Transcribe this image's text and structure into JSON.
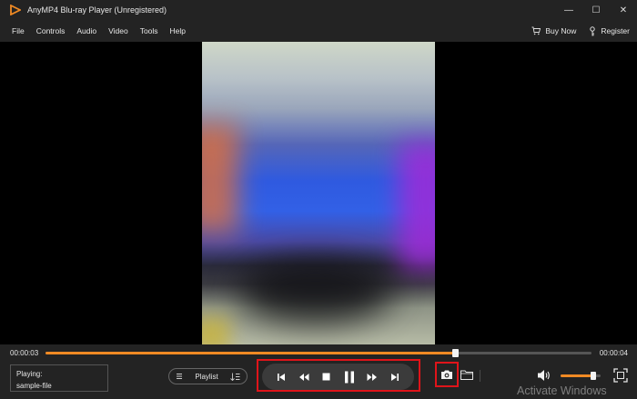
{
  "window": {
    "title": "AnyMP4 Blu-ray Player (Unregistered)",
    "minimize_glyph": "—",
    "maximize_glyph": "☐",
    "close_glyph": "✕"
  },
  "menu": {
    "items": [
      "File",
      "Controls",
      "Audio",
      "Video",
      "Tools",
      "Help"
    ],
    "buy_now": "Buy Now",
    "register": "Register"
  },
  "playback": {
    "current_time": "00:00:03",
    "duration": "00:00:04",
    "progress_fraction": 0.75
  },
  "status": {
    "playing_label": "Playing:",
    "file_name": "sample-file"
  },
  "playlist": {
    "label": "Playlist"
  },
  "volume": {
    "level_fraction": 0.82
  },
  "watermark": {
    "text": "Activate Windows"
  },
  "colors": {
    "accent": "#f08a24",
    "highlight": "#e0141a",
    "chrome": "#232323"
  },
  "icons": {
    "app": "anymp4-logo-icon",
    "buy": "cart-icon",
    "register": "key-icon",
    "previous": "skip-previous-icon",
    "rewind": "rewind-icon",
    "stop": "stop-icon",
    "pause": "pause-icon",
    "forward": "fast-forward-icon",
    "next": "skip-next-icon",
    "snapshot": "camera-icon",
    "folder": "folder-icon",
    "volume": "volume-icon",
    "fullscreen": "fullscreen-icon"
  }
}
